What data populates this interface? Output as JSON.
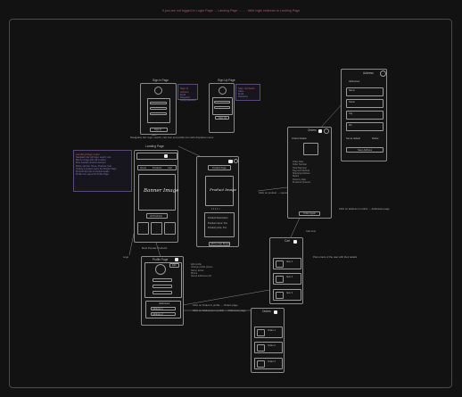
{
  "top_note": "If you are not logged in: Login Page → Landing Page → ... · After login redirects to Landing Page",
  "frames": {
    "signin": {
      "title": "Sign in Page",
      "button": "Sign In"
    },
    "signup": {
      "title": "Sign Up Page",
      "button": "Sign Up"
    },
    "landing": {
      "title": "Landing Page",
      "banner": "Banner Image",
      "cta": "All Products",
      "caption": "Most Popular Products",
      "tabs": [
        "Home",
        "Products",
        "Cart"
      ]
    },
    "product": {
      "header": "Product Page",
      "image": "Product Image",
      "dots": "• • • • ○",
      "desc": [
        "Product Description",
        "Product name: Xxx",
        "Product price: Xxx"
      ],
      "button": "Add to Cart Button"
    },
    "profile": {
      "title": "Profile Page",
      "edit": "Edit",
      "section": "Addresses",
      "rows": [
        "Address 1",
        "Address 2"
      ]
    },
    "orders": {
      "title": "Orders",
      "subtitle": "Orders Details",
      "details": [
        "Order Date",
        "Order Number",
        "Total Payment",
        "Payment Method",
        "Shipping Address",
        "Status",
        "Delivery Date",
        "Products Ordered"
      ],
      "button": "Order Again"
    },
    "addresses": {
      "title": "Address",
      "subtitle": "Addresses",
      "fields": [
        "Name",
        "Street",
        "City",
        "Zip",
        "Phone"
      ],
      "checks": [
        "Set as default",
        "Delete"
      ],
      "button": "Save Address"
    },
    "cart": {
      "title": "Cart",
      "items": [
        "Item 1",
        "Item 2",
        "Item 3"
      ]
    },
    "history": {
      "title": "Orders",
      "items": [
        "Order 1",
        "Order 2",
        "Order 3"
      ]
    }
  },
  "notes": {
    "signin_note": {
      "title": "Sign In options",
      "lines": [
        "Email",
        "Password",
        "Forgot password",
        "Sign up link"
      ]
    },
    "signup_note": {
      "title": "Sign Up fields",
      "lines": [
        "Name",
        "Email",
        "Password",
        "Confirm Password"
      ]
    },
    "landing_note": {
      "title": "Landing Page notes",
      "lines": [
        "Navigation bar with logo, search, cart",
        "Banner image with call to action",
        "Most popular products carousel",
        "Bottom tab bar: Home, Products, Cart",
        "Clicking a product opens the Product Page",
        "Products list links to product details",
        "Profile icon opens the Profile Page"
      ]
    }
  },
  "annotations": {
    "landing_top": "Navigation bar: logo, search, cart icon and profile icon with dropdown menu",
    "product_side": "Click on product → opens Product Page",
    "profile_side": [
      "Edit profile",
      "Change profile picture",
      "Name, Email",
      "Phone",
      "Saved addresses list"
    ],
    "profile_link1": "Click on Orders in profile → Orders page",
    "profile_link2": "Click on Addresses in profile → Addresses page",
    "orders_link": "Click on address in orders → Addresses page",
    "cart_side": "Cart icon",
    "history_side": "Past orders of the user with their details",
    "left_label": "Logo"
  },
  "colors": {
    "background": "#121212",
    "frame": "#8a8a8a",
    "note_text": "#c06060",
    "note_lines": "#8a7fb8"
  }
}
